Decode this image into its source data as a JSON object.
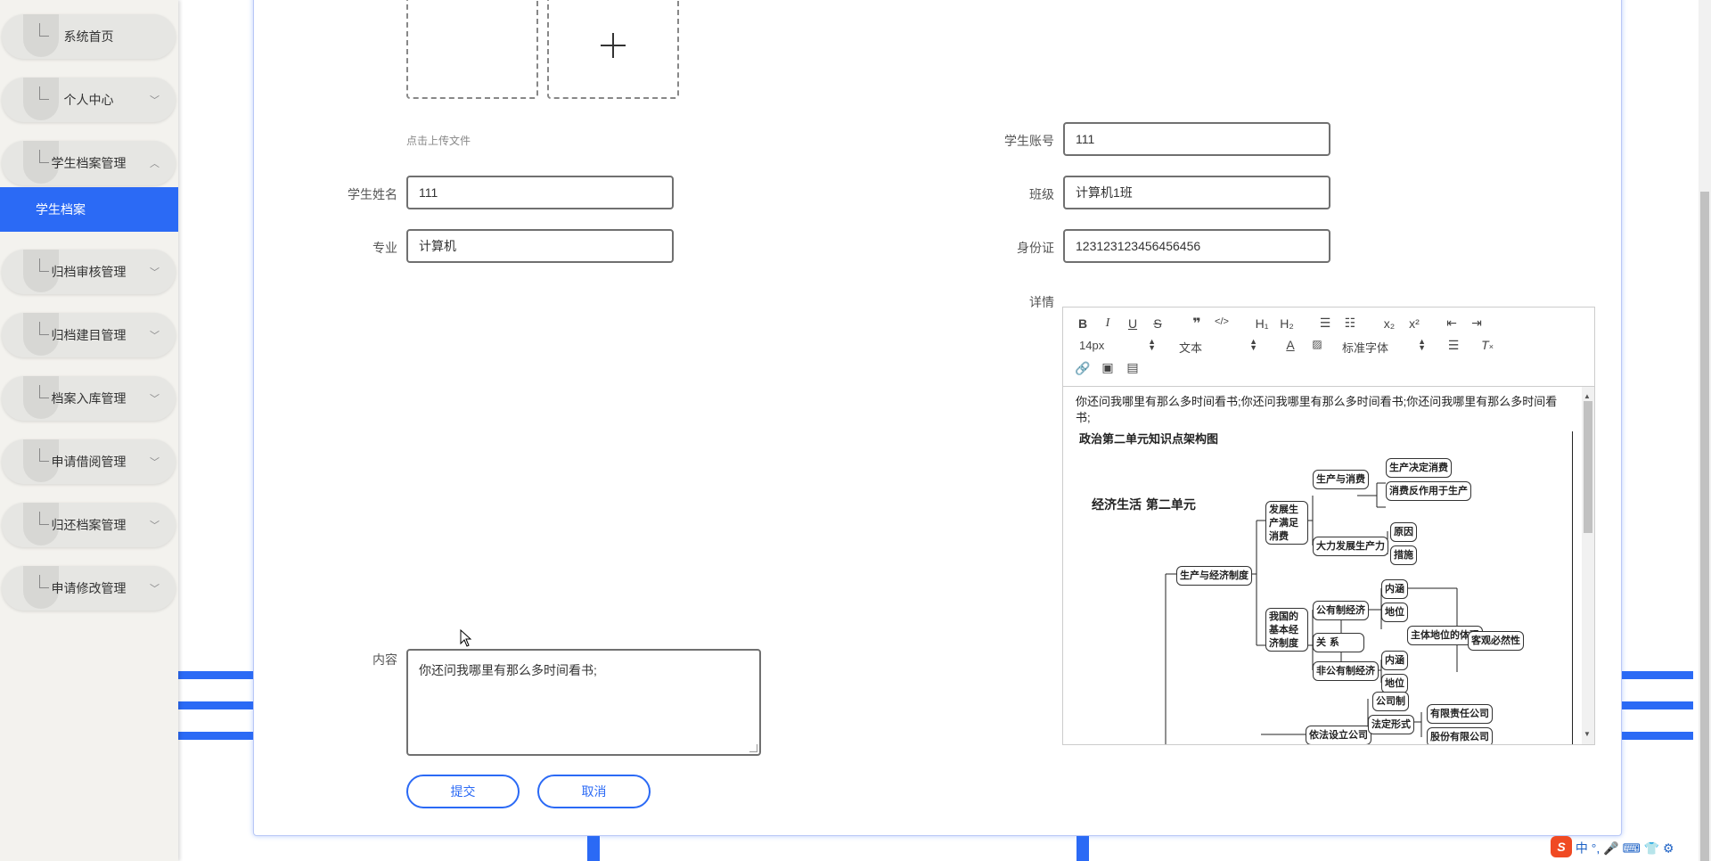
{
  "sidebar": {
    "items": [
      {
        "label": "系统首页"
      },
      {
        "label": "个人中心"
      },
      {
        "label": "学生档案管理"
      },
      {
        "label": "归档审核管理"
      },
      {
        "label": "归档建目管理"
      },
      {
        "label": "档案入库管理"
      },
      {
        "label": "申请借阅管理"
      },
      {
        "label": "归还档案管理"
      },
      {
        "label": "申请修改管理"
      }
    ],
    "active_sub": "学生档案"
  },
  "form": {
    "upload_hint": "点击上传文件",
    "student_name_label": "学生姓名",
    "student_name_value": "111",
    "major_label": "专业",
    "major_value": "计算机",
    "content_label": "内容",
    "content_value": "你还问我哪里有那么多时间看书;",
    "account_label": "学生账号",
    "account_value": "111",
    "class_label": "班级",
    "class_value": "计算机1班",
    "idcard_label": "身份证",
    "idcard_value": "123123123456456456",
    "detail_label": "详情",
    "submit": "提交",
    "cancel": "取消"
  },
  "editor": {
    "toolbar": {
      "h1": "H₁",
      "h2": "H₂",
      "sub": "x₂",
      "sup": "x²",
      "size": "14px",
      "header": "文本",
      "font": "标准字体"
    },
    "text": "你还问我哪里有那么多时间看书;你还问我哪里有那么多时间看书;你还问我哪里有那么多时间看书;",
    "image": {
      "title": "政治第二单元知识点架构图",
      "heading": "经济生活 第二单元",
      "nodes": [
        "发展生产满足消费",
        "生产与消费",
        "生产决定消费",
        "消费反作用于生产",
        "大力发展生产力",
        "原因",
        "措施",
        "生产与经济制度",
        "我国的基本经济制度",
        "公有制经济",
        "内涵",
        "地位",
        "主体地位的体现",
        "关 系",
        "非公有制经济",
        "内涵",
        "地位",
        "客观必然性",
        "依法设立公司",
        "公司制",
        "法定形式",
        "有限责任公司",
        "股份有限公司"
      ]
    }
  },
  "taskbar": {
    "ime": "中 °, 🎤 ⌨ 👕 ⚙"
  }
}
